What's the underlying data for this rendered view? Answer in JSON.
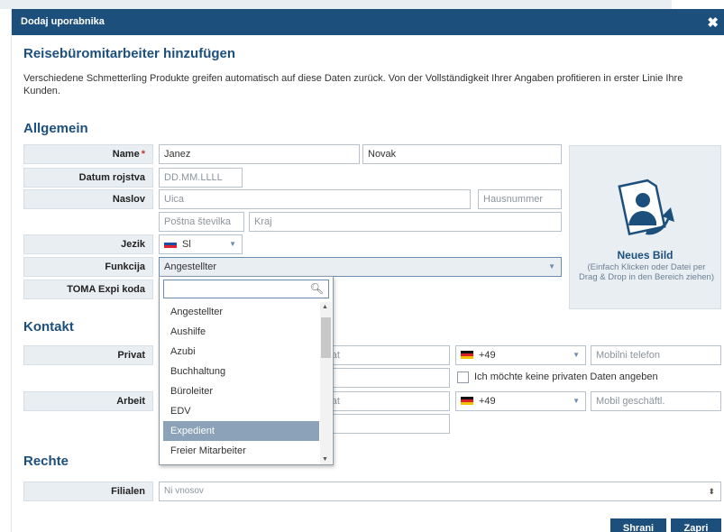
{
  "window": {
    "title": "Dodaj uporabnika",
    "close_glyph": "✖"
  },
  "header": {
    "title": "Reisebüromitarbeiter hinzufügen",
    "intro": "Verschiedene Schmetterling Produkte greifen automatisch auf diese Daten zurück. Von der Vollständigkeit Ihrer Angaben profitieren in erster Linie Ihre Kunden."
  },
  "sections": {
    "general": "Allgemein",
    "contact": "Kontakt",
    "rights": "Rechte"
  },
  "labels": {
    "name": "Name",
    "required_mark": "*",
    "birth_date": "Datum rojstva",
    "address": "Naslov",
    "language": "Jezik",
    "function": "Funkcija",
    "toma": "TOMA Expi koda",
    "private": "Privat",
    "work": "Arbeit",
    "branches": "Filialen"
  },
  "fields": {
    "first_name": "Janez",
    "last_name": "Novak",
    "birth_date_placeholder": "DD.MM.LLLL",
    "street_placeholder": "Uica",
    "house_number_placeholder": "Hausnummer",
    "postal_code_placeholder": "Poštna številka",
    "city_placeholder": "Kraj",
    "language_value": "Sl",
    "function_value": "Angestellter",
    "private_phone_partial": "privat",
    "private_email_partial": "n",
    "private_mobile_prefix": "+49",
    "private_mobile_placeholder": "Mobilni telefon",
    "no_private_data_label": "Ich möchte keine privaten Daten angeben",
    "work_phone_partial": "privat",
    "work_mobile_prefix": "+49",
    "work_mobile_placeholder": "Mobil geschäftl.",
    "branches_placeholder": "Ni vnosov"
  },
  "image_upload": {
    "title": "Neues Bild",
    "hint": "(Einfach Klicken oder Datei per Drag & Drop in den Bereich ziehen)",
    "icon": "upload-image-icon"
  },
  "function_dropdown": {
    "search_value": "",
    "options": [
      "Angestellter",
      "Aushilfe",
      "Azubi",
      "Buchhaltung",
      "Büroleiter",
      "EDV",
      "Expedient",
      "Freier Mitarbeiter"
    ],
    "highlighted": "Expedient"
  },
  "buttons": {
    "save": "Shrani",
    "close": "Zapri"
  },
  "colors": {
    "accent": "#1d4f7c",
    "label_bg": "#e9eef3",
    "highlight": "#8ba2b8",
    "required": "#c0392b"
  }
}
